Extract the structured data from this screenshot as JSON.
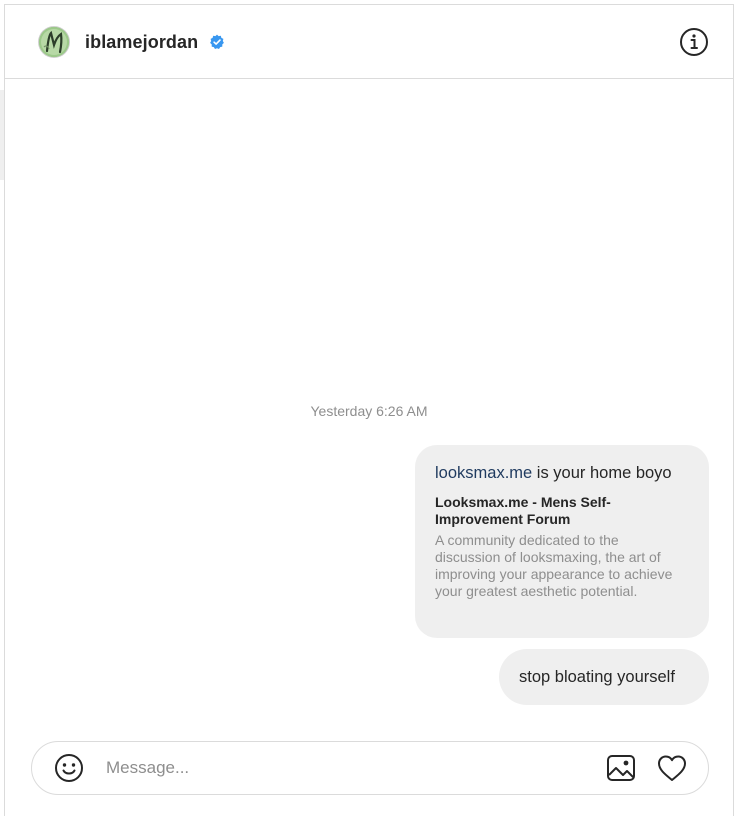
{
  "header": {
    "username": "iblamejordan",
    "verified": true,
    "avatar_icon": "user-avatar-icon",
    "info_icon": "info-icon"
  },
  "thread": {
    "timestamp": "Yesterday 6:26 AM",
    "messages": [
      {
        "link_text": "looksmax.me",
        "text_after_link": " is your home boyo",
        "preview_title": "Looksmax.me - Mens Self-Improvement Forum",
        "preview_description": "A community dedicated to the discussion of looksmaxing, the art of improving your appearance to achieve your greatest aesthetic potential."
      },
      {
        "text": "stop bloating yourself"
      }
    ]
  },
  "composer": {
    "placeholder": "Message...",
    "value": "",
    "emoji_icon": "emoji-icon",
    "image_icon": "image-icon",
    "like_icon": "heart-icon"
  },
  "colors": {
    "bubble_background": "#efefef",
    "border": "#dbdbdb",
    "secondary_text": "#8e8e8e",
    "verified_blue": "#3897f0"
  }
}
